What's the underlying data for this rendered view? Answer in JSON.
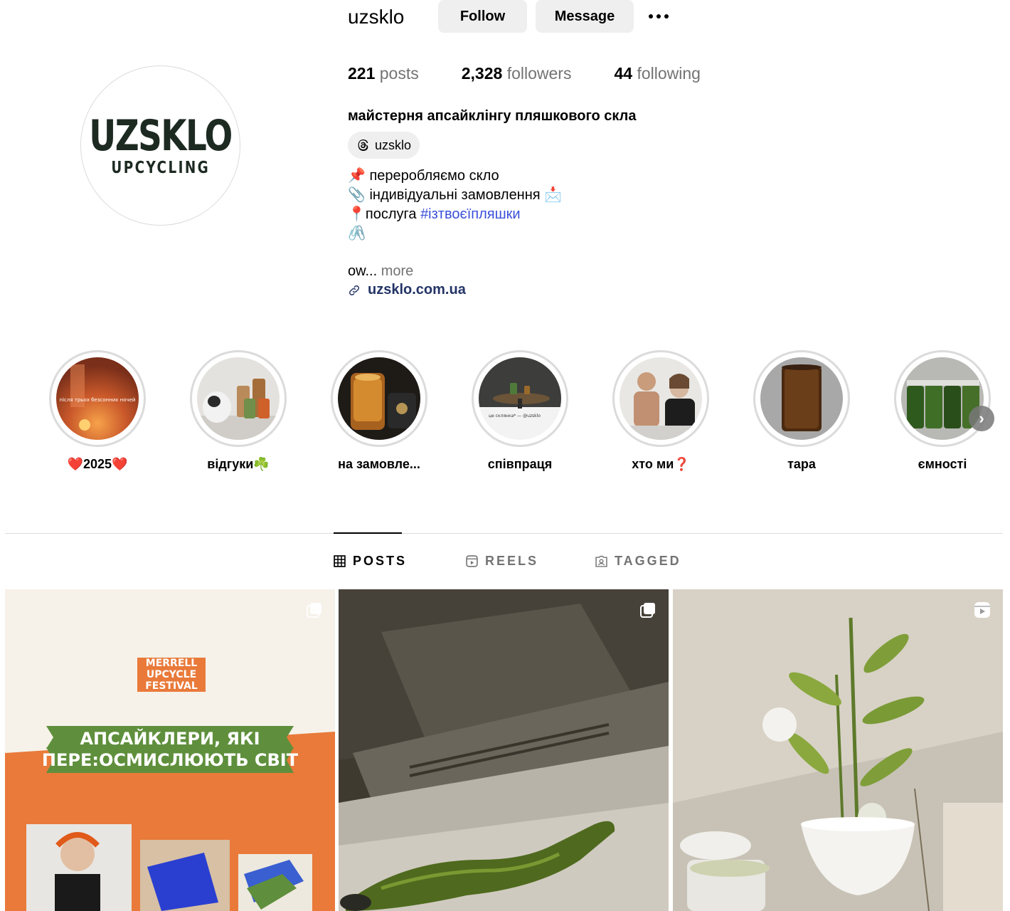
{
  "profile": {
    "username": "uzsklo",
    "follow_label": "Follow",
    "message_label": "Message",
    "logo_main": "UZSKLO",
    "logo_sub": "UPCYCLING",
    "stats": {
      "posts_count": "221",
      "posts_label": "posts",
      "followers_count": "2,328",
      "followers_label": "followers",
      "following_count": "44",
      "following_label": "following"
    },
    "full_name": "майстерня апсайклінгу пляшкового скла",
    "threads_handle": "uzsklo",
    "bio": {
      "line1": "📌 переробляємо скло",
      "line2": "📎 індивідуальні замовлення 📩",
      "line3_prefix": "📍послуга ",
      "line3_hashtag": "#ізтвоєїпляшки",
      "line4": "🖇️",
      "truncated": "ow...",
      "more": "more"
    },
    "website": "uzsklo.com.ua"
  },
  "highlights": [
    {
      "label": "❤️2025❤️",
      "caption": "після трьох безсонних ночей"
    },
    {
      "label": "відгуки☘️"
    },
    {
      "label": "на замовле..."
    },
    {
      "label": "співпраця",
      "caption": "це склянка* — @uzsklo"
    },
    {
      "label": "хто ми❓"
    },
    {
      "label": "тара"
    },
    {
      "label": "ємності"
    }
  ],
  "tabs": [
    {
      "label": "POSTS",
      "icon": "grid-icon",
      "active": true
    },
    {
      "label": "REELS",
      "icon": "reels-icon",
      "active": false
    },
    {
      "label": "TAGGED",
      "icon": "tagged-icon",
      "active": false
    }
  ],
  "posts": [
    {
      "type": "carousel",
      "festival_line1": "MERRELL",
      "festival_line2": "UPCYCLE",
      "festival_line3": "FESTIVAL",
      "banner_line1": "АПСАЙКЛЕРИ, ЯКІ",
      "banner_line2": "ПЕРЕ:ОСМИСЛЮЮТЬ СВІТ"
    },
    {
      "type": "carousel"
    },
    {
      "type": "reel"
    }
  ],
  "colors": {
    "button_bg": "#efefef",
    "secondary_text": "#737373",
    "hashtag": "#3a4fd8",
    "link": "#233366",
    "logo": "#1d2a22",
    "festival_orange": "#e97a3a",
    "festival_green": "#5f8f3c"
  }
}
